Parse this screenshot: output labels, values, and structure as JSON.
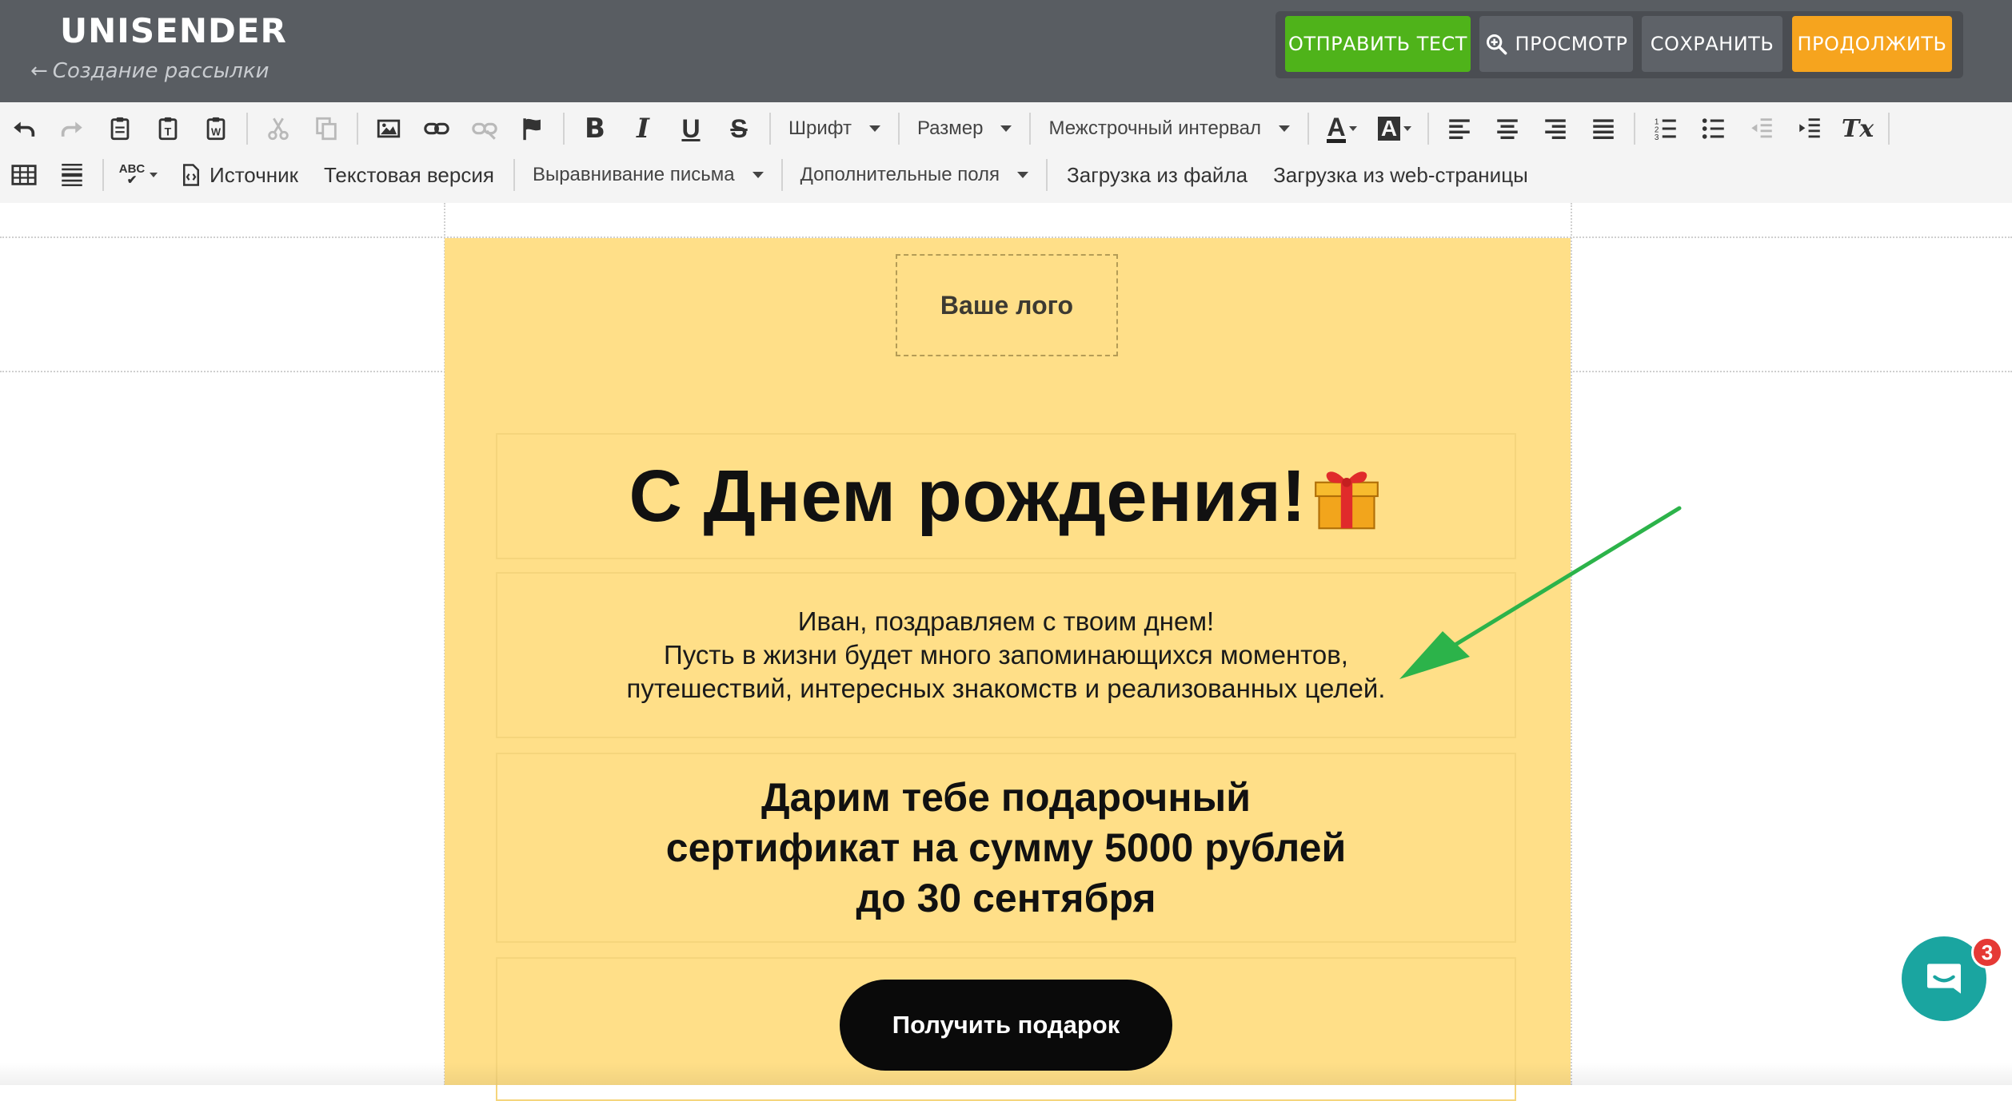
{
  "header": {
    "logo": "UNISENDER",
    "back_arrow": "←",
    "back_label": "Создание рассылки",
    "buttons": {
      "send_test": "ОТПРАВИТЬ ТЕСТ",
      "preview": "ПРОСМОТР",
      "save": "СОХРАНИТЬ",
      "continue": "ПРОДОЛЖИТЬ"
    }
  },
  "toolbar": {
    "bold": "B",
    "italic": "I",
    "underline": "U",
    "strike": "S",
    "font": "Шрифт",
    "size": "Размер",
    "line_spacing": "Межстрочный интервал",
    "text_color_glyph": "A",
    "bg_color_glyph": "A",
    "clear_format": "Tx",
    "spellcheck": "ABC",
    "source": "Источник",
    "text_version": "Текстовая версия",
    "email_align": "Выравнивание письма",
    "extra_fields": "Дополнительные поля",
    "load_file": "Загрузка из файла",
    "load_web": "Загрузка из web-страницы"
  },
  "email": {
    "logo_placeholder": "Ваше лого",
    "title": "С Днем рождения!",
    "greeting": {
      "line1": "Иван, поздравляем с твоим днем!",
      "line2": "Пусть в жизни будет много запоминающихся моментов,",
      "line3": "путешествий, интересных знакомств и реализованных целей."
    },
    "certificate": {
      "line1": "Дарим тебе подарочный",
      "line2": "сертификат на сумму 5000 рублей",
      "line3": "до 30 сентября"
    },
    "cta": "Получить подарок"
  },
  "chat": {
    "badge": "3"
  },
  "colors": {
    "header_bg": "#595d62",
    "send_test": "#4fb31a",
    "continue": "#f6a41e",
    "email_bg": "#ffdf88",
    "arrow": "#2cb34a",
    "chat": "#1aa5a0"
  }
}
